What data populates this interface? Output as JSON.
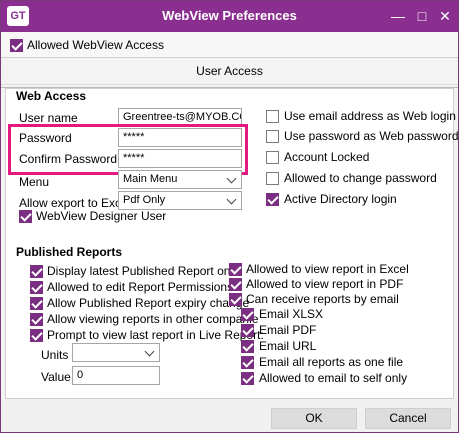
{
  "window": {
    "logo_text": "GT",
    "title": "WebView Preferences",
    "title_color": "#8a2f8f",
    "accent_color": "#7b2f82",
    "highlight_color": "#e3197f",
    "icons": [
      "minimize-icon",
      "maximize-icon",
      "close-icon"
    ]
  },
  "top": {
    "allowed_webview_access": {
      "label": "Allowed WebView Access",
      "checked": true
    }
  },
  "section_title": "User Access",
  "web_access": {
    "heading": "Web Access",
    "user_name": {
      "label": "User name",
      "value": "Greentree-ts@MYOB.COM"
    },
    "password": {
      "label": "Password",
      "value": "*****"
    },
    "confirm_password": {
      "label": "Confirm Password",
      "value": "*****"
    },
    "menu": {
      "label": "Menu",
      "value": "Main Menu"
    },
    "allow_export": {
      "label": "Allow export to Excel",
      "value": "Pdf Only"
    },
    "webview_designer_user": {
      "label": "WebView Designer User",
      "checked": true
    }
  },
  "right_options": [
    {
      "label": "Use email address as Web login ID",
      "checked": false
    },
    {
      "label": "Use password as Web password",
      "checked": false
    },
    {
      "label": "Account Locked",
      "checked": false
    },
    {
      "label": "Allowed to change password",
      "checked": false
    },
    {
      "label": "Active Directory login",
      "checked": true
    }
  ],
  "published_reports": {
    "heading": "Published Reports",
    "left": [
      {
        "label": "Display latest Published Report onl",
        "checked": true
      },
      {
        "label": "Allowed to edit Report Permissions",
        "checked": true
      },
      {
        "label": "Allow Published Report expiry change",
        "checked": true
      },
      {
        "label": "Allow viewing reports in other companie",
        "checked": true
      },
      {
        "label": "Prompt to view last report in Live Report:",
        "checked": true
      }
    ],
    "units": {
      "label": "Units",
      "value": ""
    },
    "value": {
      "label": "Value",
      "value": "0"
    },
    "right": [
      {
        "label": "Allowed to view report in Excel",
        "checked": true
      },
      {
        "label": "Allowed to view report in PDF",
        "checked": true
      },
      {
        "label": "Can receive reports by email",
        "checked": true
      }
    ],
    "email": [
      {
        "label": "Email XLSX",
        "checked": true
      },
      {
        "label": "Email PDF",
        "checked": true
      },
      {
        "label": "Email URL",
        "checked": true
      },
      {
        "label": "Email all reports as one file",
        "checked": true
      },
      {
        "label": "Allowed to email to self only",
        "checked": true
      }
    ]
  },
  "buttons": {
    "ok": "OK",
    "cancel": "Cancel"
  }
}
